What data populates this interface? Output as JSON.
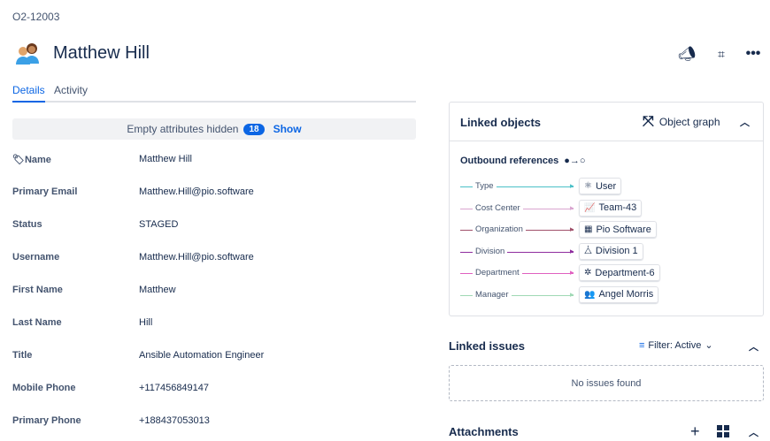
{
  "object_key": "O2-12003",
  "title": "Matthew Hill",
  "header_icons": [
    "megaphone-icon",
    "qr-code-icon",
    "more-icon"
  ],
  "tabs": [
    {
      "label": "Details"
    },
    {
      "label": "Activity"
    }
  ],
  "hidden_bar": {
    "text": "Empty attributes hidden",
    "count": "18",
    "show": "Show"
  },
  "attributes": [
    {
      "label": "Name",
      "value": "Matthew Hill"
    },
    {
      "label": "Primary Email",
      "value": "Matthew.Hill@pio.software"
    },
    {
      "label": "Status",
      "value": "STAGED"
    },
    {
      "label": "Username",
      "value": "Matthew.Hill@pio.software"
    },
    {
      "label": "First Name",
      "value": "Matthew"
    },
    {
      "label": "Last Name",
      "value": "Hill"
    },
    {
      "label": "Title",
      "value": "Ansible Automation Engineer"
    },
    {
      "label": "Mobile Phone",
      "value": "+117456849147"
    },
    {
      "label": "Primary Phone",
      "value": "+188437053013"
    }
  ],
  "linked_objects": {
    "title": "Linked objects",
    "graph_label": "Object graph",
    "outbound_label": "Outbound references",
    "refs": [
      {
        "label": "Type",
        "target": "User",
        "color": "#4bc0c8",
        "icon": "⚛"
      },
      {
        "label": "Cost Center",
        "target": "Team-43",
        "color": "#d9a5d0",
        "icon": "📈"
      },
      {
        "label": "Organization",
        "target": "Pio Software",
        "color": "#a0506a",
        "icon": "▦"
      },
      {
        "label": "Division",
        "target": "Division 1",
        "color": "#8e2c9e",
        "icon": "⧊"
      },
      {
        "label": "Department",
        "target": "Department-6",
        "color": "#e060c0",
        "icon": "✲"
      },
      {
        "label": "Manager",
        "target": "Angel Morris",
        "color": "#9fd8b4",
        "icon": "👥"
      }
    ]
  },
  "linked_issues": {
    "title": "Linked issues",
    "filter": "Filter: Active",
    "empty": "No issues found"
  },
  "attachments": {
    "title": "Attachments"
  }
}
